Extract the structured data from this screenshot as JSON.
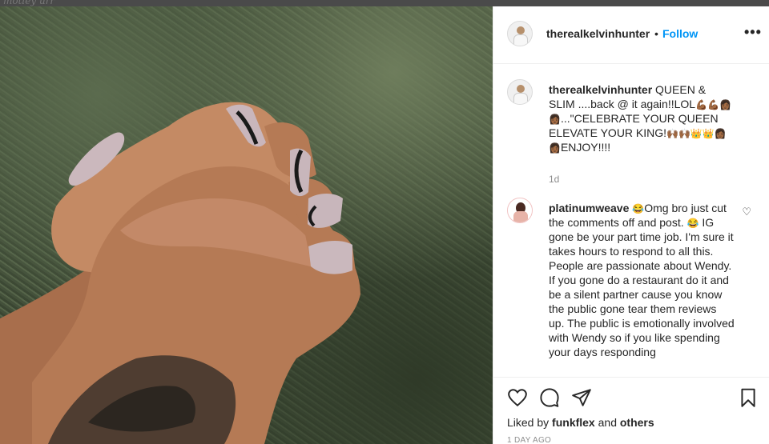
{
  "page_behind": {
    "title_fragment": "motley urr",
    "icons": [
      "home-icon",
      "messenger-icon",
      "explore-icon",
      "activity-icon"
    ]
  },
  "post": {
    "author": "therealkelvinhunter",
    "separator": "•",
    "follow_label": "Follow",
    "more_icon": "more-horizontal-icon",
    "more_label": "•••",
    "photo_alt": "Two clasped hands with long lilac coffin nails"
  },
  "caption": {
    "username": "therealkelvinhunter",
    "text_1": " QUEEN & SLIM ....back @ it again!!LOL",
    "emoji_1": "💪🏾💪🏾👩🏾",
    "emoji_2": "👩🏾",
    "text_2": "...\"CELEBRATE YOUR QUEEN ELEVATE YOUR KING!",
    "emoji_3": "🙌🏾🙌🏾👑👑👩🏾",
    "emoji_4": "👩🏾",
    "text_3": "ENJOY!!!!",
    "time": "1d"
  },
  "comment": {
    "username": "platinumweave",
    "emoji_a": "😂",
    "text_a": "Omg bro just cut the comments off and post. ",
    "emoji_b": "😂",
    "text_b": " IG gone be your part time job. I'm sure it takes hours to respond to all this. People are passionate about Wendy. If you gone do a restaurant do it and be a silent partner cause you know the public gone tear them reviews up. The public is emotionally involved with Wendy so if you like spending your days responding",
    "like_icon": "heart-outline-icon",
    "like_label": "♡"
  },
  "actions": {
    "like_icon": "heart-outline-icon",
    "comment_icon": "comment-bubble-icon",
    "share_icon": "paper-plane-icon",
    "save_icon": "bookmark-icon"
  },
  "likes": {
    "prefix": "Liked by ",
    "user": "funkflex",
    "middle": " and ",
    "others": "others"
  },
  "date": "1 DAY AGO"
}
